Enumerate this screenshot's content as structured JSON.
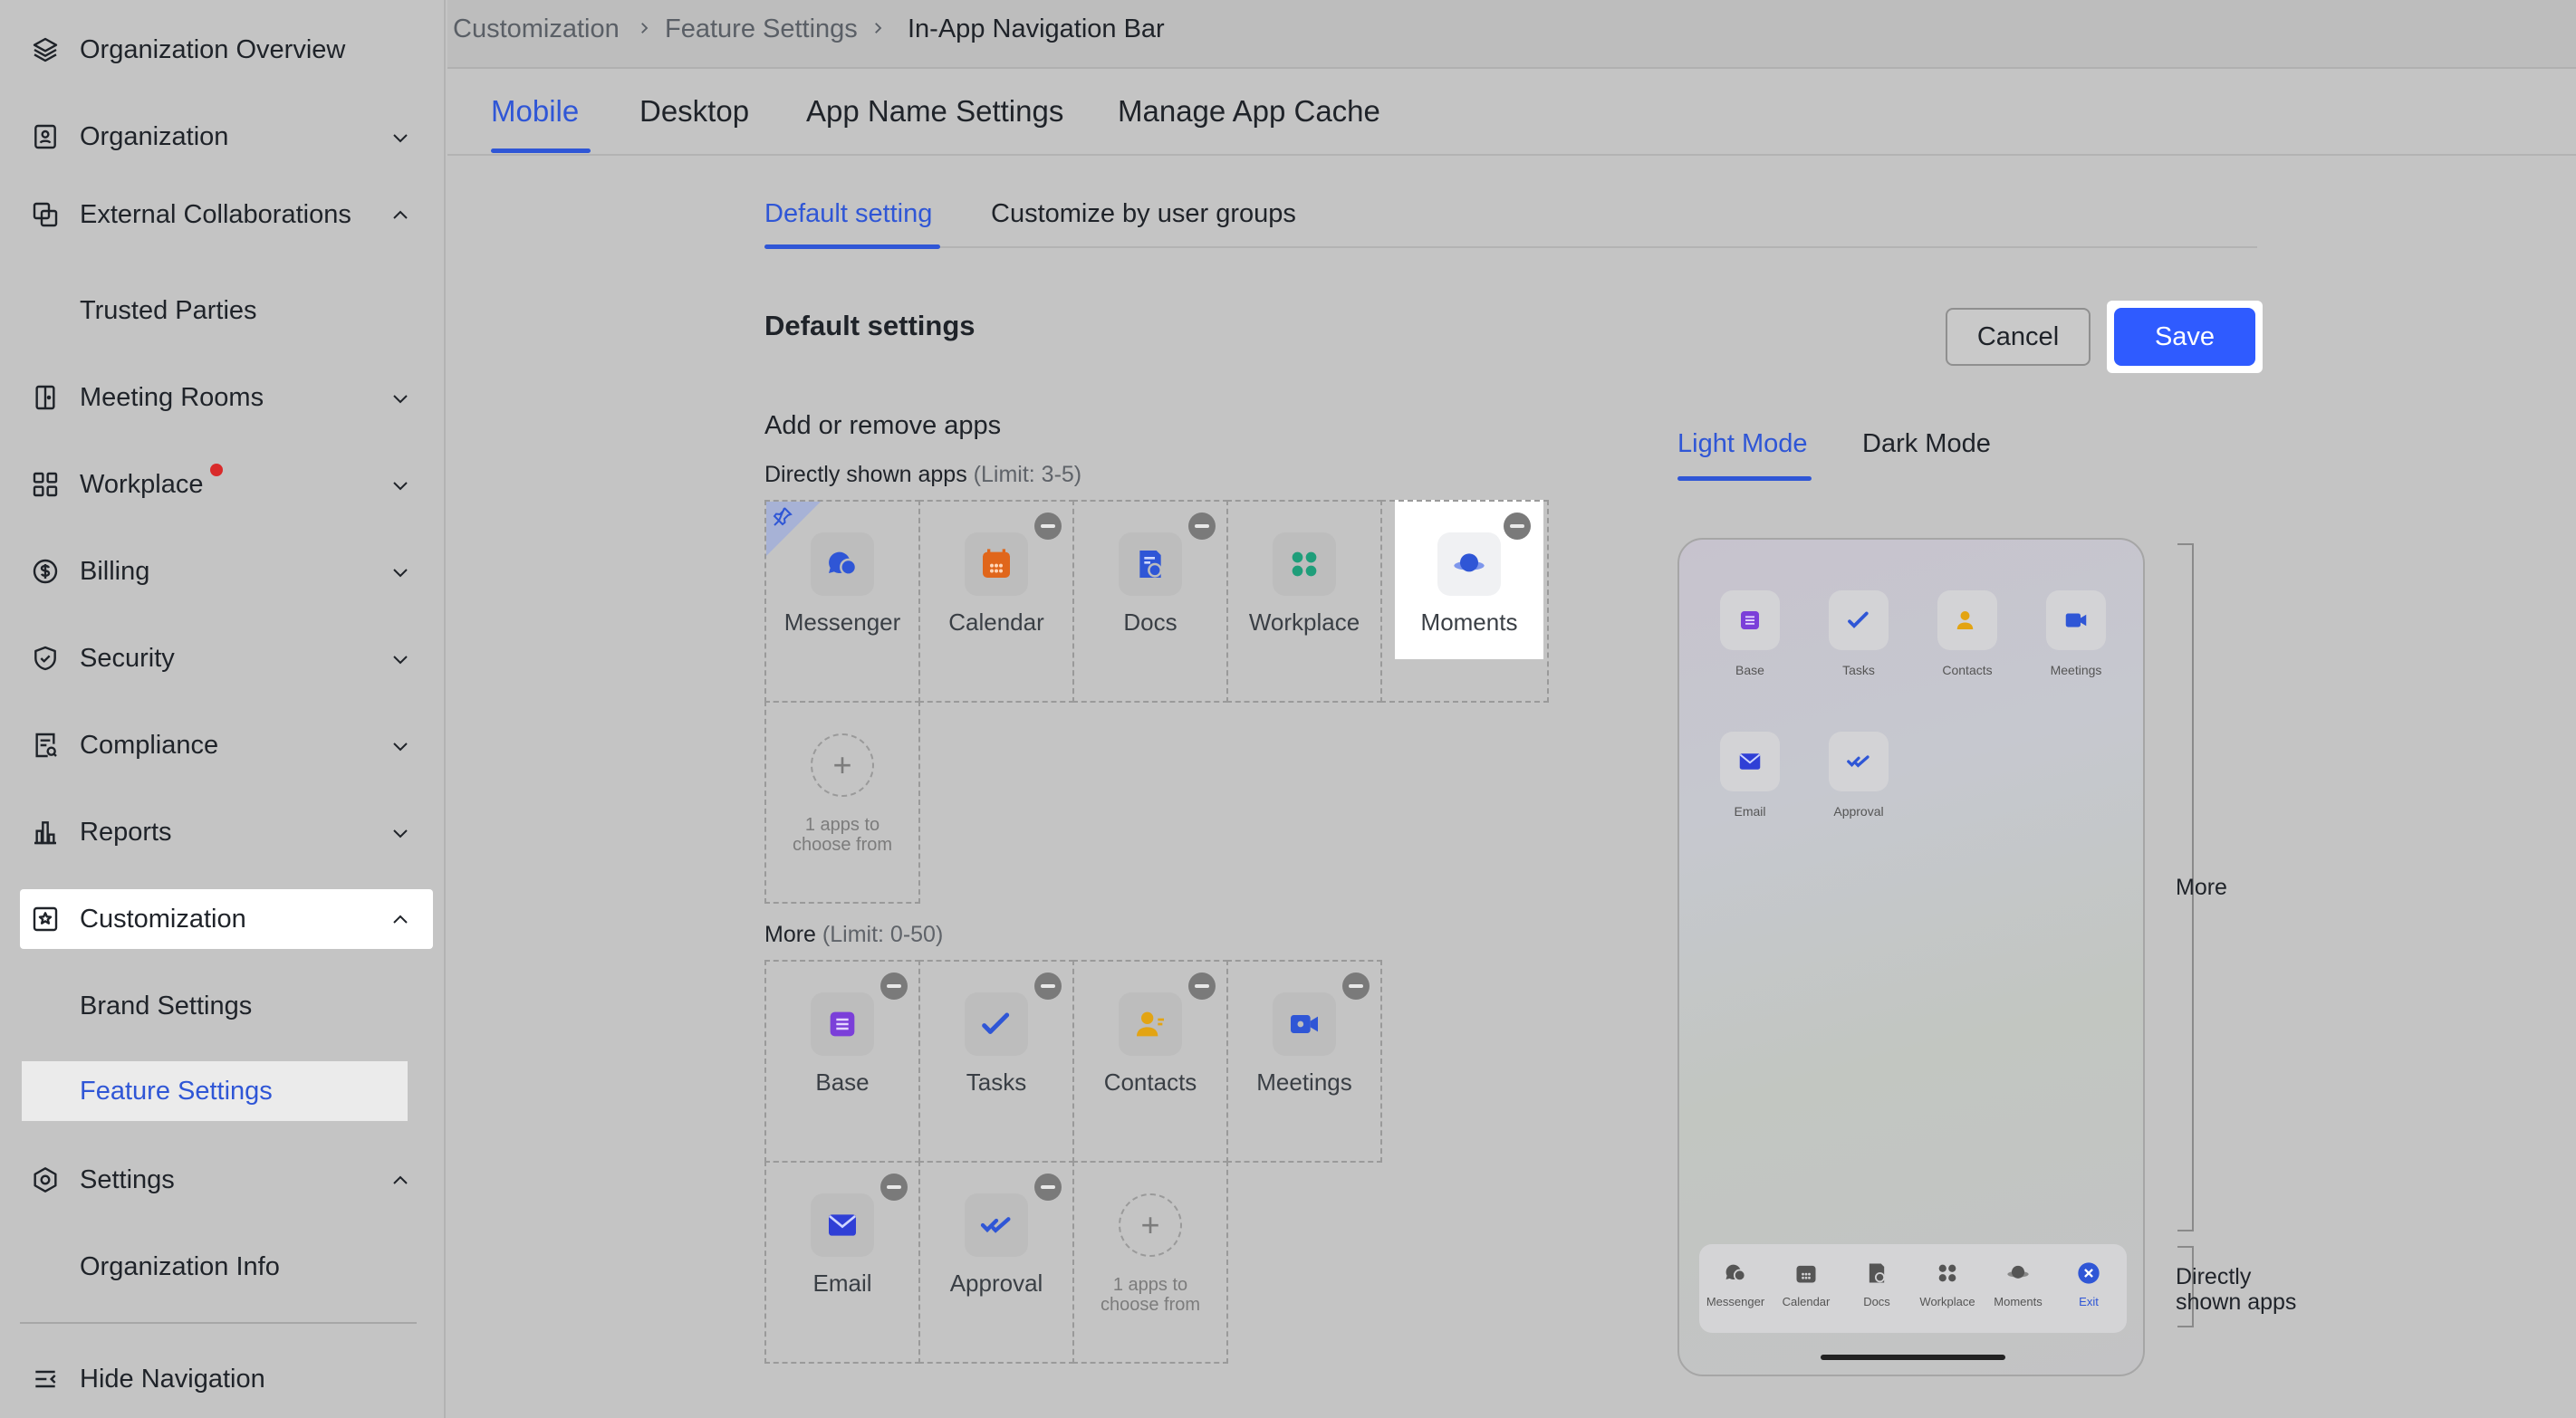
{
  "sidebar": {
    "items": [
      {
        "label": "Organization Overview"
      },
      {
        "label": "Organization"
      },
      {
        "label": "External Collaborations"
      },
      {
        "label": "Trusted Parties"
      },
      {
        "label": "Meeting Rooms"
      },
      {
        "label": "Workplace"
      },
      {
        "label": "Billing"
      },
      {
        "label": "Security"
      },
      {
        "label": "Compliance"
      },
      {
        "label": "Reports"
      },
      {
        "label": "Customization"
      },
      {
        "label": "Brand Settings"
      },
      {
        "label": "Feature Settings"
      },
      {
        "label": "Settings"
      },
      {
        "label": "Organization Info"
      }
    ],
    "hide_navigation": "Hide Navigation"
  },
  "breadcrumb": [
    "Customization",
    "Feature Settings",
    "In-App Navigation Bar"
  ],
  "main_tabs": [
    "Mobile",
    "Desktop",
    "App Name Settings",
    "Manage App Cache"
  ],
  "sub_tabs": [
    "Default setting",
    "Customize by user groups"
  ],
  "section_title": "Default settings",
  "buttons": {
    "cancel": "Cancel",
    "save": "Save"
  },
  "add_remove_label": "Add or remove apps",
  "direct": {
    "label": "Directly shown apps",
    "limit": "(Limit: 3-5)",
    "apps": [
      "Messenger",
      "Calendar",
      "Docs",
      "Workplace",
      "Moments"
    ],
    "add_text": "1 apps to choose from"
  },
  "more": {
    "label": "More",
    "limit": "(Limit: 0-50)",
    "apps": [
      "Base",
      "Tasks",
      "Contacts",
      "Meetings",
      "Email",
      "Approval"
    ],
    "add_text": "1 apps to choose from"
  },
  "preview": {
    "modes": [
      "Light Mode",
      "Dark Mode"
    ],
    "grid_apps": [
      "Base",
      "Tasks",
      "Contacts",
      "Meetings",
      "Email",
      "Approval"
    ],
    "tab_bar": [
      "Messenger",
      "Calendar",
      "Docs",
      "Workplace",
      "Moments",
      "Exit"
    ],
    "annotation_more": "More",
    "annotation_direct": "Directly shown apps"
  },
  "colors": {
    "accent": "#2f56d6",
    "save": "#2f5bff",
    "alert_dot": "#d92a2a"
  }
}
